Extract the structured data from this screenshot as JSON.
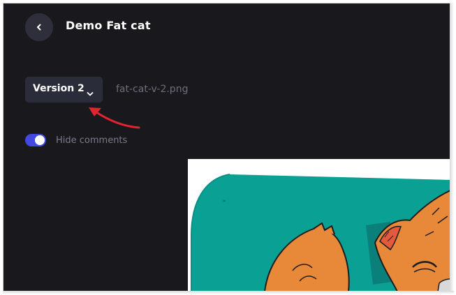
{
  "header": {
    "back_button_label": "Back",
    "title": "Demo Fat cat"
  },
  "version_selector": {
    "selected": "Version 2"
  },
  "file": {
    "name": "fat-cat-v-2.png"
  },
  "comments_toggle": {
    "label": "Hide comments",
    "enabled": true
  },
  "preview": {
    "alt": "Fat cat illustration"
  },
  "colors": {
    "background": "#19191d",
    "button_bg": "#2e2f3b",
    "toggle_accent": "#4248e0",
    "annotation_arrow": "#e0252f",
    "teal": "#0aa094",
    "cat_orange": "#e8893a"
  },
  "icons": {
    "back": "chevron-left-icon",
    "dropdown": "chevron-down-icon",
    "annotation": "red-arrow-icon"
  }
}
